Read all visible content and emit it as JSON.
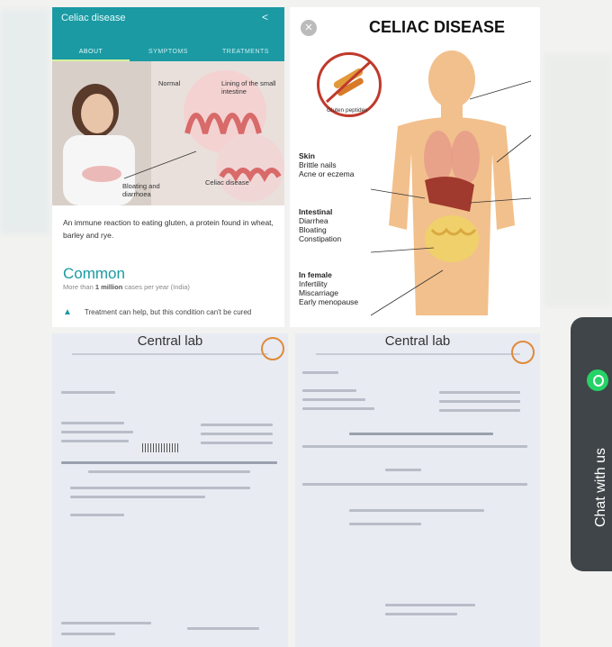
{
  "app_card": {
    "title": "Celiac disease",
    "tabs": [
      "ABOUT",
      "SYMPTOMS",
      "TREATMENTS"
    ],
    "labels": {
      "normal": "Normal",
      "lining": "Lining of the small intestine",
      "bloating": "Bloating and diarrhoea",
      "celiac": "Celiac disease"
    },
    "description": "An immune reaction to eating gluten, a protein found in wheat, barley and rye.",
    "common_heading": "Common",
    "cases_prefix": "More than",
    "cases_bold": "1 million",
    "cases_suffix": "cases per year (India)",
    "treatment": "Treatment can help, but this condition can't be cured"
  },
  "diagram": {
    "title": "CELIAC DISEASE",
    "gluten_label": "Gluten peptides",
    "skin": {
      "head": "Skin",
      "items": [
        "Brittle nails",
        "Acne or eczema"
      ]
    },
    "intestinal": {
      "head": "Intestinal",
      "items": [
        "Diarrhea",
        "Bloating",
        "Constipation"
      ]
    },
    "female": {
      "head": "In female",
      "items": [
        "Infertility",
        "Miscarriage",
        "Early menopause"
      ]
    }
  },
  "lab_left": {
    "title": "Central lab"
  },
  "lab_right": {
    "title": "Central lab"
  },
  "chat": {
    "label": "Chat with us"
  },
  "colors": {
    "teal": "#1b9aa4",
    "chat_bg": "#3f4548",
    "whatsapp": "#25d366"
  }
}
